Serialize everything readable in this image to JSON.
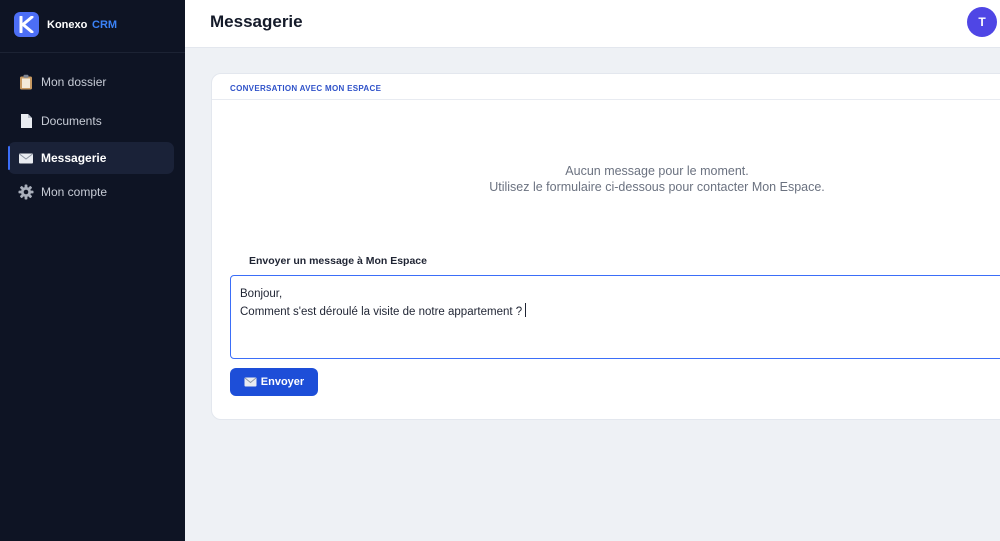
{
  "brand": {
    "name": "Konexo",
    "suffix": "CRM",
    "logo_letter": "K"
  },
  "sidebar": {
    "items": [
      {
        "label": "Mon dossier",
        "icon": "clipboard-icon",
        "active": false
      },
      {
        "label": "Documents",
        "icon": "document-icon",
        "active": false
      },
      {
        "label": "Messagerie",
        "icon": "envelope-icon",
        "active": true
      },
      {
        "label": "Mon compte",
        "icon": "gear-icon",
        "active": false
      }
    ]
  },
  "header": {
    "title": "Messagerie",
    "avatar_initial": "T"
  },
  "conversation": {
    "title": "CONVERSATION AVEC MON ESPACE",
    "empty_line1": "Aucun message pour le moment.",
    "empty_line2": "Utilisez le formulaire ci-dessous pour contacter Mon Espace."
  },
  "form": {
    "label": "Envoyer un message à Mon Espace",
    "message_line1": "Bonjour,",
    "message_line2": "Comment s'est déroulé la visite de notre appartement ?",
    "send_label": "Envoyer",
    "send_icon": "envelope-icon"
  },
  "colors": {
    "sidebar_bg": "#0e1424",
    "accent": "#1d4ed8",
    "brand_crm": "#3b82f6",
    "avatar_bg": "#4f46e5",
    "page_bg": "#eef1f5"
  }
}
